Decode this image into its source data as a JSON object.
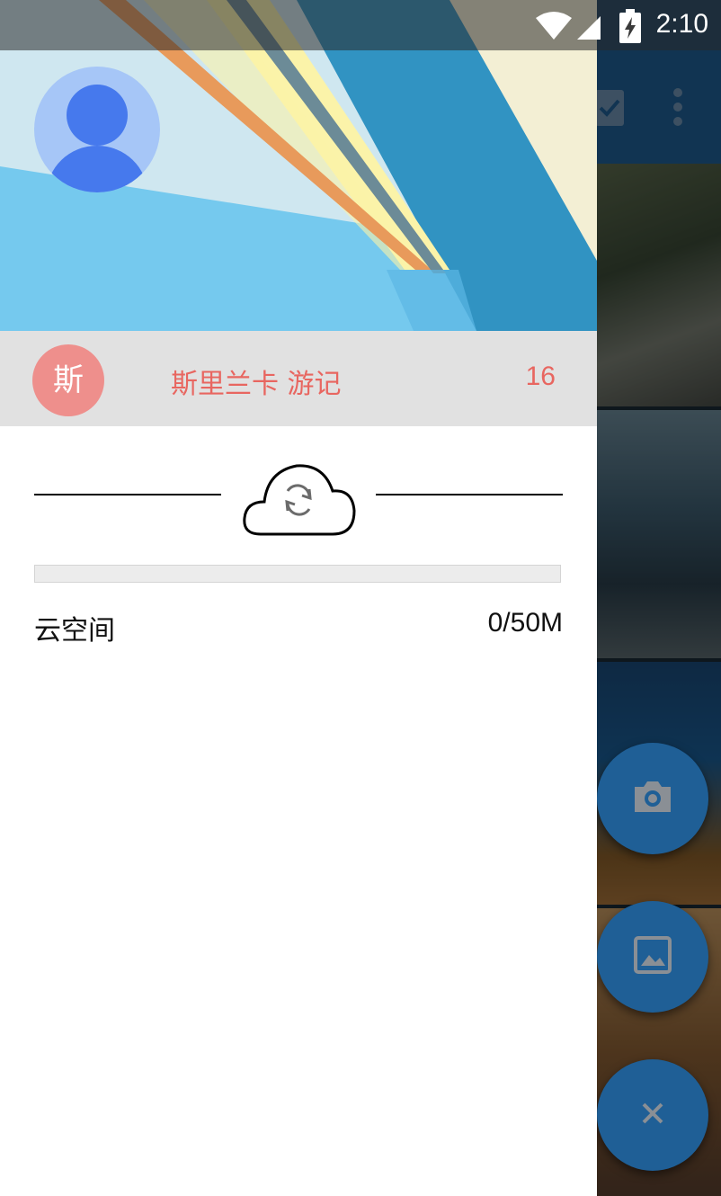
{
  "status_bar": {
    "time": "2:10",
    "icons": [
      "wifi-icon",
      "signal-icon",
      "battery-charging-icon"
    ]
  },
  "drawer": {
    "header": {
      "avatar": "account-avatar-icon"
    },
    "album": {
      "badge": "斯",
      "title": "斯里兰卡 游记",
      "count": "16"
    },
    "sync": {
      "icon": "cloud-sync-icon"
    },
    "storage": {
      "label": "云空间",
      "value": "0/50M",
      "used_fraction": 0
    }
  },
  "background_app": {
    "toolbar_icons": [
      "select-all-icon",
      "more-vert-icon"
    ],
    "fabs": [
      "camera-icon",
      "image-icon",
      "close-icon"
    ]
  },
  "colors": {
    "accent": "#1f5f96",
    "album_text": "#e86660",
    "album_badge": "#ee8f8c",
    "header_bg": "#75c9ee"
  }
}
